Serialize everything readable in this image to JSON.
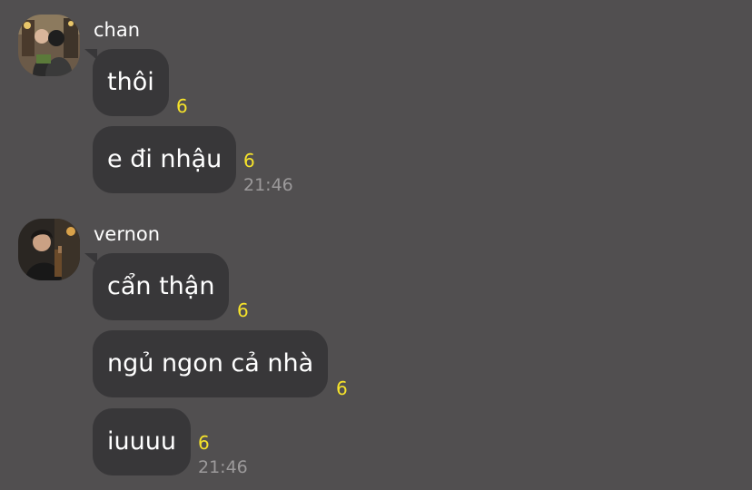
{
  "groups": [
    {
      "sender": "chan",
      "avatar_icon": "user-avatar-chan",
      "messages": [
        {
          "text": "thôi",
          "unread": "6",
          "time": ""
        },
        {
          "text": "e đi nhậu",
          "unread": "6",
          "time": "21:46"
        }
      ]
    },
    {
      "sender": "vernon",
      "avatar_icon": "user-avatar-vernon",
      "messages": [
        {
          "text": "cẩn thận",
          "unread": "6",
          "time": ""
        },
        {
          "text": "ngủ ngon cả nhà",
          "unread": "6",
          "time": ""
        },
        {
          "text": "iuuuu",
          "unread": "6",
          "time": "21:46"
        }
      ]
    }
  ],
  "colors": {
    "background": "#514f50",
    "bubble": "#383739",
    "unread": "#f6e32a",
    "time": "#9c9a9b"
  }
}
